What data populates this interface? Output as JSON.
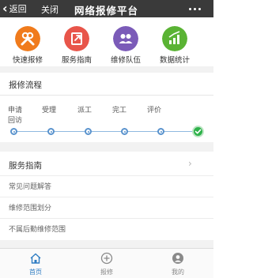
{
  "topbar": {
    "back_label": "返回",
    "close_label": "关闭",
    "title": "网络报修平台"
  },
  "quick_actions": [
    {
      "label": "快速报修",
      "icon": "wrench-icon",
      "color": "#f07b1c"
    },
    {
      "label": "服务指南",
      "icon": "share-icon",
      "color": "#e8554a"
    },
    {
      "label": "维修队伍",
      "icon": "team-icon",
      "color": "#7b5bb8"
    },
    {
      "label": "数据统计",
      "icon": "chart-icon",
      "color": "#5ab334"
    }
  ],
  "flow": {
    "title": "报修流程",
    "steps": [
      "申请",
      "受理",
      "派工",
      "完工",
      "评价",
      "回访"
    ],
    "accent": "#5a93cd",
    "done_color": "#2eb24a"
  },
  "guide": {
    "title": "服务指南",
    "items": [
      "常见问题解答",
      "维修范围划分",
      "不属后勤维修范围"
    ]
  },
  "tabbar": {
    "tabs": [
      {
        "label": "首页",
        "icon": "home-icon",
        "active": true
      },
      {
        "label": "报修",
        "icon": "plus-circle-icon",
        "active": false
      },
      {
        "label": "我的",
        "icon": "user-icon",
        "active": false
      }
    ],
    "active_color": "#2f7dc3"
  }
}
